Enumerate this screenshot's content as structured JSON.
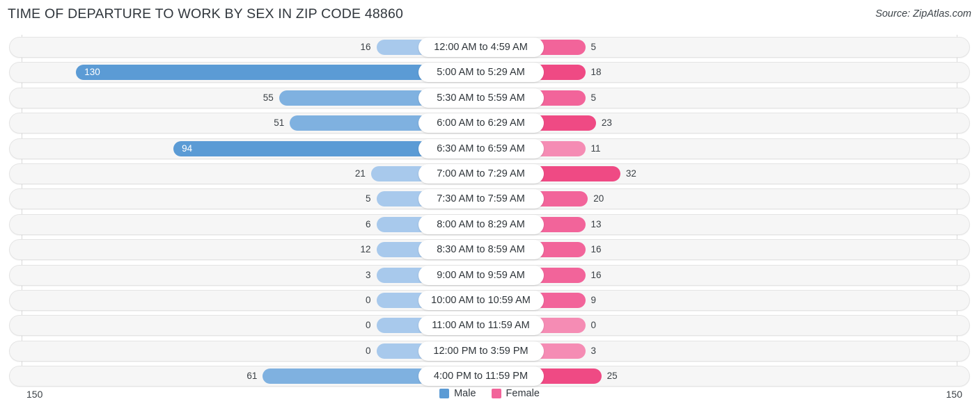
{
  "header": {
    "title": "TIME OF DEPARTURE TO WORK BY SEX IN ZIP CODE 48860",
    "source": "Source: ZipAtlas.com"
  },
  "axis": {
    "left_label": "150",
    "right_label": "150",
    "max": 150
  },
  "legend": {
    "items": [
      {
        "label": "Male",
        "color": "#5b9bd5"
      },
      {
        "label": "Female",
        "color": "#f2649a"
      }
    ]
  },
  "colors": {
    "male_dark": "#5b9bd5",
    "male_mid": "#7fb1e0",
    "male_light": "#a8c9ec",
    "female_dark": "#ef4a84",
    "female_mid": "#f2649a",
    "female_light": "#f58cb4",
    "track_bg": "#f6f6f6",
    "track_border": "#e4e4e4",
    "gridline": "#d9d9d9",
    "title": "#31373d"
  },
  "chart_data": {
    "type": "bar",
    "title": "TIME OF DEPARTURE TO WORK BY SEX IN ZIP CODE 48860",
    "subtitle": "Source: ZipAtlas.com",
    "orientation": "horizontal-diverging",
    "xlabel": "",
    "ylabel": "",
    "xlim": [
      150,
      150
    ],
    "grid": true,
    "legend_position": "bottom-center",
    "categories": [
      "12:00 AM to 4:59 AM",
      "5:00 AM to 5:29 AM",
      "5:30 AM to 5:59 AM",
      "6:00 AM to 6:29 AM",
      "6:30 AM to 6:59 AM",
      "7:00 AM to 7:29 AM",
      "7:30 AM to 7:59 AM",
      "8:00 AM to 8:29 AM",
      "8:30 AM to 8:59 AM",
      "9:00 AM to 9:59 AM",
      "10:00 AM to 10:59 AM",
      "11:00 AM to 11:59 AM",
      "12:00 PM to 3:59 PM",
      "4:00 PM to 11:59 PM"
    ],
    "series": [
      {
        "name": "Male",
        "color": "#5b9bd5",
        "values": [
          16,
          130,
          55,
          51,
          94,
          21,
          5,
          6,
          12,
          3,
          0,
          0,
          0,
          61
        ]
      },
      {
        "name": "Female",
        "color": "#f2649a",
        "values": [
          5,
          18,
          5,
          23,
          11,
          32,
          20,
          13,
          16,
          16,
          9,
          0,
          3,
          25
        ]
      }
    ]
  },
  "rows": [
    {
      "label": "12:00 AM to 4:59 AM",
      "male": 16,
      "male_text": "16",
      "female": 5,
      "female_text": "5",
      "male_shade": "light",
      "female_shade": "mid",
      "male_inside": false
    },
    {
      "label": "5:00 AM to 5:29 AM",
      "male": 130,
      "male_text": "130",
      "female": 18,
      "female_text": "18",
      "male_shade": "dark",
      "female_shade": "dark",
      "male_inside": true
    },
    {
      "label": "5:30 AM to 5:59 AM",
      "male": 55,
      "male_text": "55",
      "female": 5,
      "female_text": "5",
      "male_shade": "mid",
      "female_shade": "mid",
      "male_inside": false
    },
    {
      "label": "6:00 AM to 6:29 AM",
      "male": 51,
      "male_text": "51",
      "female": 23,
      "female_text": "23",
      "male_shade": "mid",
      "female_shade": "dark",
      "male_inside": false
    },
    {
      "label": "6:30 AM to 6:59 AM",
      "male": 94,
      "male_text": "94",
      "female": 11,
      "female_text": "11",
      "male_shade": "dark",
      "female_shade": "light",
      "male_inside": true
    },
    {
      "label": "7:00 AM to 7:29 AM",
      "male": 21,
      "male_text": "21",
      "female": 32,
      "female_text": "32",
      "male_shade": "light",
      "female_shade": "dark",
      "male_inside": false
    },
    {
      "label": "7:30 AM to 7:59 AM",
      "male": 5,
      "male_text": "5",
      "female": 20,
      "female_text": "20",
      "male_shade": "light",
      "female_shade": "mid",
      "male_inside": false
    },
    {
      "label": "8:00 AM to 8:29 AM",
      "male": 6,
      "male_text": "6",
      "female": 13,
      "female_text": "13",
      "male_shade": "light",
      "female_shade": "mid",
      "male_inside": false
    },
    {
      "label": "8:30 AM to 8:59 AM",
      "male": 12,
      "male_text": "12",
      "female": 16,
      "female_text": "16",
      "male_shade": "light",
      "female_shade": "mid",
      "male_inside": false
    },
    {
      "label": "9:00 AM to 9:59 AM",
      "male": 3,
      "male_text": "3",
      "female": 16,
      "female_text": "16",
      "male_shade": "light",
      "female_shade": "mid",
      "male_inside": false
    },
    {
      "label": "10:00 AM to 10:59 AM",
      "male": 0,
      "male_text": "0",
      "female": 9,
      "female_text": "9",
      "male_shade": "light",
      "female_shade": "mid",
      "male_inside": false
    },
    {
      "label": "11:00 AM to 11:59 AM",
      "male": 0,
      "male_text": "0",
      "female": 0,
      "female_text": "0",
      "male_shade": "light",
      "female_shade": "light",
      "male_inside": false
    },
    {
      "label": "12:00 PM to 3:59 PM",
      "male": 0,
      "male_text": "0",
      "female": 3,
      "female_text": "3",
      "male_shade": "light",
      "female_shade": "light",
      "male_inside": false
    },
    {
      "label": "4:00 PM to 11:59 PM",
      "male": 61,
      "male_text": "61",
      "female": 25,
      "female_text": "25",
      "male_shade": "mid",
      "female_shade": "dark",
      "male_inside": false
    }
  ]
}
